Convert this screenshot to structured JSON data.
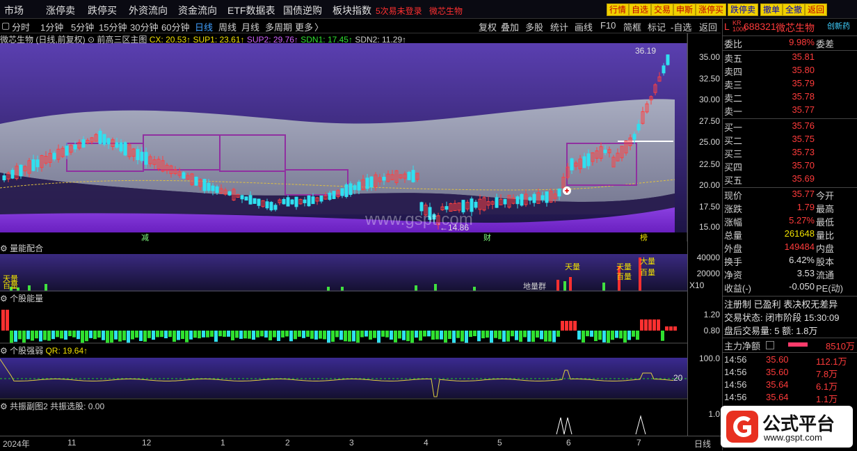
{
  "menu": [
    "市场",
    "涨停卖",
    "跌停买",
    "外资流向",
    "资金流向",
    "ETF数据表",
    "国债逆购",
    "板块指数"
  ],
  "menu_notice": "5次易未登录",
  "menu_stock": "微芯生物",
  "quick_buttons": [
    "行情",
    "自选",
    "交易",
    "申斯",
    "涨停买",
    "跌停卖",
    "撤单",
    "全撤",
    "返回"
  ],
  "periods": [
    "分时",
    "1分钟",
    "5分钟",
    "15分钟",
    "30分钟",
    "60分钟",
    "日线",
    "周线",
    "月线",
    "多周期",
    "更多"
  ],
  "selected_period": "日线",
  "tools": [
    "复权",
    "叠加",
    "多股",
    "统计",
    "画线",
    "F10",
    "简框",
    "标记",
    "-自选",
    "返回"
  ],
  "main_chart": {
    "label": "微芯生物 (日线,前复权)",
    "indicator": "前高三区主图",
    "cx": "CX: 20.53↑",
    "sup1": "SUP1: 23.61↑",
    "sup2": "SUP2: 29.76↑",
    "sdn1": "SDN1: 17.45↑",
    "sdn2": "SDN2: 11.29↑",
    "high_label": "36.19",
    "low_label": "14.86",
    "marks": [
      "减",
      "财",
      "榜"
    ],
    "y_ticks": [
      "35.00",
      "32.50",
      "30.00",
      "27.50",
      "25.00",
      "22.50",
      "20.00",
      "17.50",
      "15.00"
    ]
  },
  "vol_panel": {
    "title": "量能配合",
    "ticks": [
      "40000",
      "20000"
    ],
    "unit": "X10",
    "annot": "地量群",
    "labels": [
      "天量",
      "百量",
      "天量",
      "百量",
      "大量",
      "百量"
    ]
  },
  "energy_panel": {
    "title": "个股能量",
    "ticks": [
      "1.20",
      "0.80"
    ]
  },
  "strength_panel": {
    "title": "个股强弱",
    "qr": "QR: 19.64↑",
    "ticks": [
      "100.0"
    ],
    "level": "20"
  },
  "resonance_panel": {
    "title": "共振副图2",
    "sub": "共振选股: 0.00",
    "ticks": [
      "1.0"
    ]
  },
  "x_axis": [
    "2024年",
    "11",
    "12",
    "1",
    "2",
    "3",
    "4",
    "5",
    "6",
    "7"
  ],
  "period_tag": "日线",
  "watermark": "www.gspt.com",
  "stock": {
    "flag": "L",
    "code": "688321",
    "name": "微芯生物",
    "tag": "创新药"
  },
  "quote": {
    "weibi": "9.98%",
    "weibi_label": "委比",
    "weicha_label": "委差",
    "sells": [
      {
        "k": "卖五",
        "v": "35.81"
      },
      {
        "k": "卖四",
        "v": "35.80"
      },
      {
        "k": "卖三",
        "v": "35.79"
      },
      {
        "k": "卖二",
        "v": "35.78"
      },
      {
        "k": "卖一",
        "v": "35.77"
      }
    ],
    "buys": [
      {
        "k": "买一",
        "v": "35.76"
      },
      {
        "k": "买二",
        "v": "35.75"
      },
      {
        "k": "买三",
        "v": "35.73"
      },
      {
        "k": "买四",
        "v": "35.70"
      },
      {
        "k": "买五",
        "v": "35.69"
      }
    ],
    "stats": [
      {
        "k": "现价",
        "v": "35.77",
        "k2": "今开"
      },
      {
        "k": "涨跌",
        "v": "1.79",
        "k2": "最高"
      },
      {
        "k": "涨幅",
        "v": "5.27%",
        "k2": "最低"
      },
      {
        "k": "总量",
        "v": "261648",
        "k2": "量比"
      },
      {
        "k": "外盘",
        "v": "149484",
        "k2": "内盘"
      },
      {
        "k": "换手",
        "v": "6.42%",
        "k2": "股本"
      },
      {
        "k": "净资",
        "v": "3.53",
        "k2": "流通"
      },
      {
        "k": "收益(-)",
        "v": "-0.050",
        "k2": "PE(动)"
      }
    ],
    "info1": "注册制 已盈利 表决权无差异",
    "info2": "交易状态: 闭市阶段 15:30:09",
    "info3": "盘后交易量: 5  额: 1.8万",
    "net_label": "主力净额",
    "net_value": "8510万",
    "ticks": [
      {
        "t": "14:56",
        "p": "35.60",
        "v": "112.1万"
      },
      {
        "t": "14:56",
        "p": "35.60",
        "v": "7.8万"
      },
      {
        "t": "14:56",
        "p": "35.64",
        "v": "6.1万"
      },
      {
        "t": "14:56",
        "p": "35.64",
        "v": "1.1万"
      }
    ]
  },
  "logo": {
    "text": "公式平台",
    "url": "www.gspt.com"
  },
  "colors": {
    "up": "#ff3b3b",
    "down": "#20d0e0",
    "accent": "#f0d000",
    "band": "#9a9ab0",
    "purple": "#a040e0"
  }
}
